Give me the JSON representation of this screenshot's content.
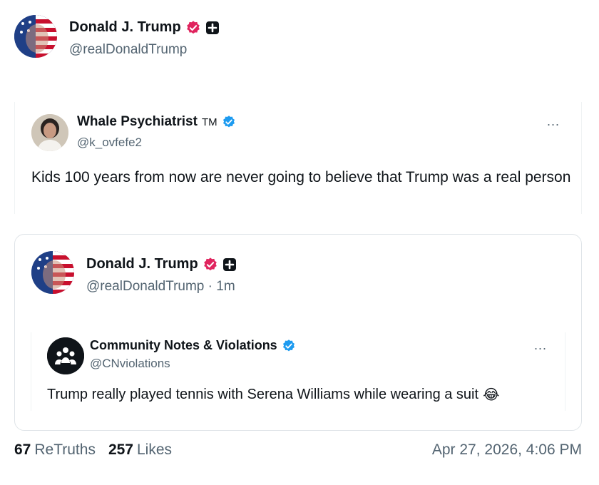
{
  "post": {
    "author_name": "Donald J. Trump",
    "author_handle": "@realDonaldTrump"
  },
  "quote1": {
    "author_name": "Whale Psychiatrist",
    "author_suffix": "TM",
    "author_handle": "@k_ovfefe2",
    "more": "...",
    "text": "Kids 100 years from now are never going to believe that Trump was a real person"
  },
  "quote2": {
    "author_name": "Donald J. Trump",
    "author_handle_time": "@realDonaldTrump · 1m",
    "nested": {
      "author_name": "Community Notes & Violations",
      "author_handle": "@CNviolations",
      "more": "...",
      "text": "Trump really played tennis with Serena Williams while wearing a suit",
      "emoji": "😂"
    }
  },
  "footer": {
    "retruths_count": "67",
    "retruths_label": "ReTruths",
    "likes_count": "257",
    "likes_label": "Likes",
    "timestamp": "Apr 27, 2026, 4:06 PM"
  },
  "colors": {
    "verified_red": "#e0245e",
    "verified_blue": "#1d9bf0",
    "text_primary": "#0f1419",
    "text_secondary": "#536471"
  },
  "icons": {
    "verified_red": "verified-badge-red-icon",
    "verified_blue": "verified-badge-blue-icon",
    "plus": "plus-square-icon",
    "community": "community-people-icon"
  }
}
